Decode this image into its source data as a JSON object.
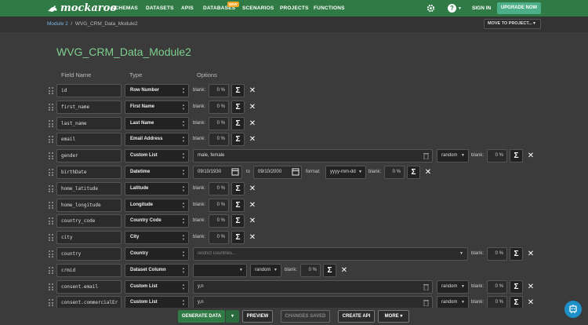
{
  "nav": {
    "logo": "mockaroo",
    "items": [
      "SCHEMAS",
      "DATASETS",
      "APIS",
      "DATABASES",
      "SCENARIOS",
      "PROJECTS",
      "FUNCTIONS"
    ],
    "new_badge": "NEW",
    "sign_in": "SIGN IN",
    "upgrade": "UPGRADE NOW",
    "gear_icon": "gear-icon",
    "help_icon": "help-icon"
  },
  "breadcrumb": {
    "parent": "Module 2",
    "separator": "/",
    "current": "WVG_CRM_Data_Module2"
  },
  "move_to_project": "MOVE TO PROJECT...",
  "schema_title": "WVG_CRM_Data_Module2",
  "headers": {
    "field_name": "Field Name",
    "type": "Type",
    "options": "Options"
  },
  "labels": {
    "blank": "blank:",
    "to": "to",
    "format": "format:",
    "sigma": "Σ",
    "close": "✕"
  },
  "fields": [
    {
      "name": "id",
      "type": "Row Number",
      "blank": "0 %"
    },
    {
      "name": "first_name",
      "type": "First Name",
      "blank": "0 %"
    },
    {
      "name": "last_name",
      "type": "Last Name",
      "blank": "0 %"
    },
    {
      "name": "email",
      "type": "Email Address",
      "blank": "0 %"
    },
    {
      "name": "gender",
      "type": "Custom List",
      "values": "male, female",
      "order": "random",
      "blank": "0 %"
    },
    {
      "name": "birthDate",
      "type": "Datetime",
      "from": "09/10/1930",
      "to": "09/10/2000",
      "format": "yyyy-mm-dd",
      "blank": "0 %"
    },
    {
      "name": "home_latitude",
      "type": "Latitude",
      "blank": "0 %"
    },
    {
      "name": "home_longitude",
      "type": "Longitude",
      "blank": "0 %"
    },
    {
      "name": "country_code",
      "type": "Country Code",
      "blank": "0 %"
    },
    {
      "name": "city",
      "type": "City",
      "blank": "0 %"
    },
    {
      "name": "country",
      "type": "Country",
      "restrict_placeholder": "restrict countries...",
      "blank": "0 %"
    },
    {
      "name": "crmid",
      "type": "Dataset Column",
      "dataset_value": "",
      "order": "random",
      "blank": "0 %"
    },
    {
      "name": "consent.email",
      "type": "Custom List",
      "values": "y,n",
      "order": "random",
      "blank": "0 %"
    },
    {
      "name": "consent.commercialEr",
      "type": "Custom List",
      "values": "y,n",
      "order": "random",
      "blank": "0 %"
    }
  ],
  "bottom": {
    "generate": "GENERATE DATA",
    "preview": "PREVIEW",
    "changes_saved": "CHANGES SAVED",
    "create_api": "CREATE API",
    "more": "MORE"
  },
  "colors": {
    "brand": "#2f7a45",
    "accent": "#4cae87",
    "title": "#7ed08e",
    "chat": "#1e90c8"
  }
}
